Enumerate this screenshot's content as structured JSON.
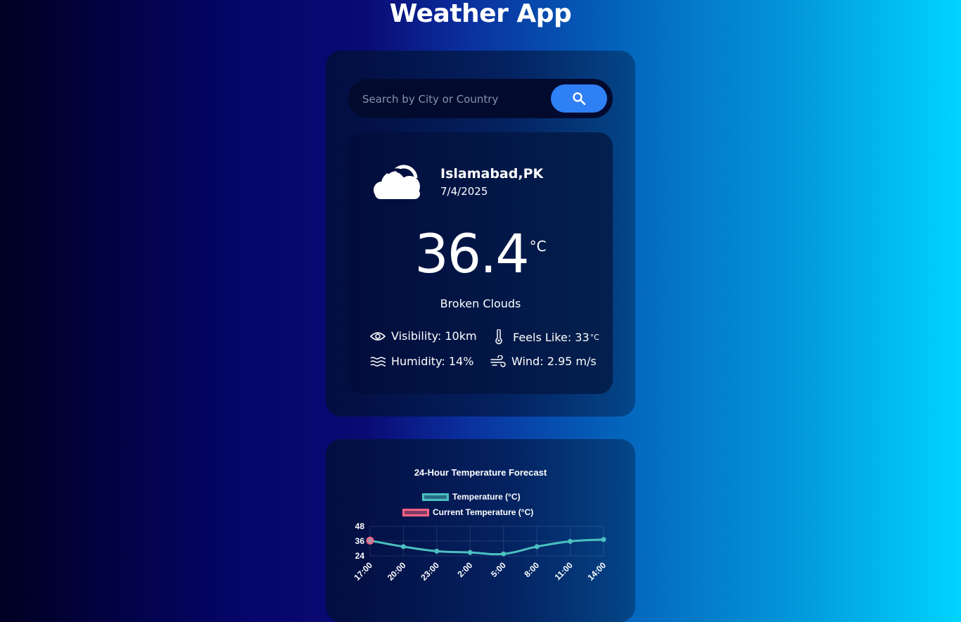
{
  "app": {
    "title": "Weather App"
  },
  "search": {
    "placeholder": "Search by City or Country",
    "value": "",
    "icon": "search-icon"
  },
  "current": {
    "location": "Islamabad,PK",
    "date": "7/4/2025",
    "icon": "cloud-icon",
    "temperature": "36.4",
    "unit": "°C",
    "condition": "Broken Clouds",
    "stats": {
      "visibility": {
        "icon": "eye-icon",
        "label": "Visibility: 10km"
      },
      "feels_like": {
        "icon": "thermometer-icon",
        "label": "Feels Like: 33",
        "unit": "°C"
      },
      "humidity": {
        "icon": "humidity-icon",
        "label": "Humidity: 14%"
      },
      "wind": {
        "icon": "wind-icon",
        "label": "Wind: 2.95 m/s"
      }
    }
  },
  "colors": {
    "accent": "#2f7ff5",
    "temperature_line": "#4bc0c0",
    "current_point": "#ff6384"
  },
  "chart_data": {
    "type": "line",
    "title": "24-Hour Temperature Forecast",
    "categories": [
      "17:00",
      "20:00",
      "23:00",
      "2:00",
      "5:00",
      "8:00",
      "11:00",
      "14:00"
    ],
    "series": [
      {
        "name": "Temperature (°C)",
        "values": [
          36.4,
          31.5,
          27.8,
          26.8,
          25.6,
          31.5,
          35.8,
          37.3
        ]
      },
      {
        "name": "Current Temperature (°C)",
        "values": [
          36.4,
          null,
          null,
          null,
          null,
          null,
          null,
          null
        ]
      }
    ],
    "yticks": [
      48,
      36,
      24
    ],
    "ylim": [
      24,
      48
    ],
    "legend": "top",
    "grid": true
  }
}
